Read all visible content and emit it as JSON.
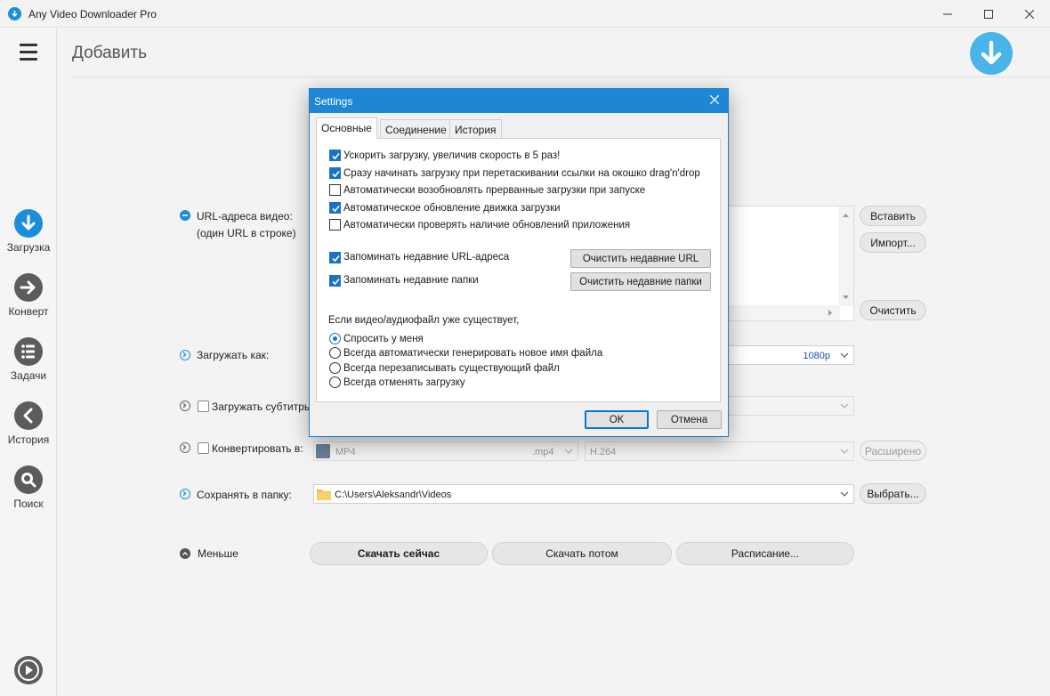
{
  "window": {
    "title": "Any Video Downloader Pro"
  },
  "sidebar": {
    "items": [
      {
        "label": "Загрузка",
        "icon": "download-icon",
        "active": true
      },
      {
        "label": "Конверт",
        "icon": "convert-arrow-icon",
        "active": false
      },
      {
        "label": "Задачи",
        "icon": "tasks-list-icon",
        "active": false
      },
      {
        "label": "История",
        "icon": "history-back-icon",
        "active": false
      },
      {
        "label": "Поиск",
        "icon": "search-icon",
        "active": false
      }
    ]
  },
  "main": {
    "title": "Добавить",
    "url_label": "URL-адреса видео:",
    "url_sublabel": "(один URL в строке)",
    "paste_button": "Вставить",
    "import_button": "Импорт...",
    "clear_button": "Очистить",
    "download_as_label": "Загружать как:",
    "quality_value": "1080p",
    "subtitles_label": "Загружать субтитры",
    "convert_label": "Конвертировать в:",
    "format_value": "MP4",
    "format_ext": ".mp4",
    "codec_value": "H.264",
    "advanced_button": "Расширено",
    "save_to_label": "Сохранять в папку:",
    "folder_value": "C:\\Users\\Aleksandr\\Videos",
    "browse_button": "Выбрать...",
    "less_label": "Меньше",
    "download_now": "Скачать сейчас",
    "download_later": "Скачать потом",
    "schedule": "Расписание..."
  },
  "dialog": {
    "title": "Settings",
    "tabs": [
      "Основные",
      "Соединение",
      "История"
    ],
    "options": [
      {
        "label": "Ускорить загрузку, увеличив скорость в 5 раз!",
        "checked": true
      },
      {
        "label": "Сразу начинать загрузку при перетаскивании ссылки на окошко drag'n'drop",
        "checked": true
      },
      {
        "label": "Автоматически возобновлять прерванные загрузки при запуске",
        "checked": false
      },
      {
        "label": "Автоматическое обновление движка загрузки",
        "checked": true
      },
      {
        "label": "Автоматически проверять наличие обновлений приложения",
        "checked": false
      }
    ],
    "remember_urls": {
      "label": "Запоминать недавние URL-адреса",
      "checked": true
    },
    "remember_folders": {
      "label": "Запоминать недавние папки",
      "checked": true
    },
    "clear_urls_button": "Очистить недавние URL",
    "clear_folders_button": "Очистить недавние папки",
    "exists_heading": "Если видео/аудиофайл уже существует,",
    "exists_options": [
      {
        "label": "Спросить у меня",
        "selected": true
      },
      {
        "label": "Всегда автоматически генерировать новое имя файла",
        "selected": false
      },
      {
        "label": "Всегда перезаписывать существующий файл",
        "selected": false
      },
      {
        "label": "Всегда отменять загрузку",
        "selected": false
      }
    ],
    "ok_button": "OK",
    "cancel_button": "Отмена"
  },
  "colors": {
    "accent": "#1a8fd9",
    "dialog_title": "#1f86d6",
    "checkbox_on": "#1a72c8"
  }
}
